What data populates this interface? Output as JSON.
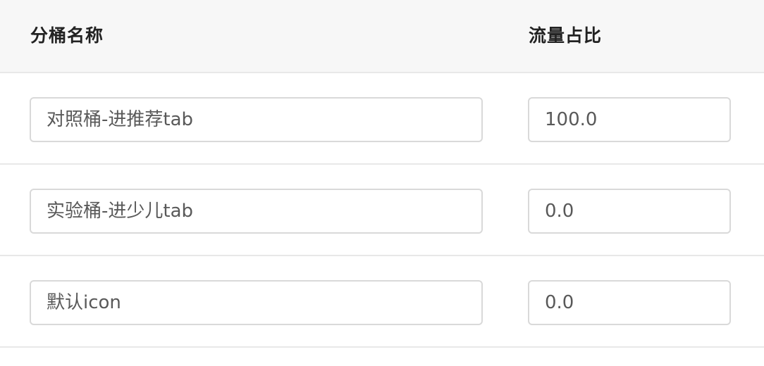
{
  "table": {
    "columns": {
      "name": "分桶名称",
      "ratio": "流量占比"
    },
    "rows": [
      {
        "name": "对照桶-进推荐tab",
        "ratio": "100.0"
      },
      {
        "name": "实验桶-进少儿tab",
        "ratio": "0.0"
      },
      {
        "name": "默认icon",
        "ratio": "0.0"
      }
    ]
  }
}
